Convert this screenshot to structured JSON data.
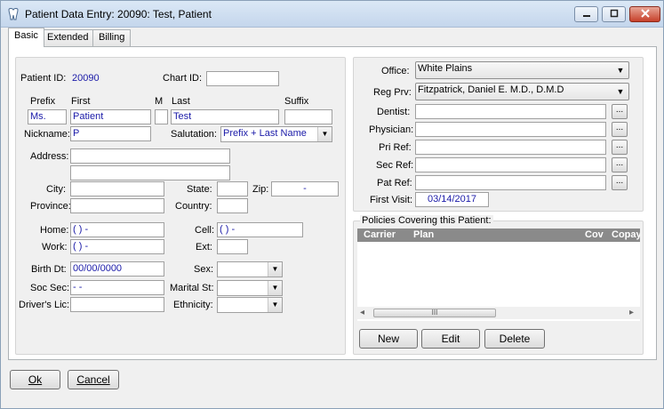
{
  "window": {
    "title": "Patient Data Entry: 20090: Test, Patient"
  },
  "tabs": [
    {
      "label": "Basic",
      "active": true
    },
    {
      "label": "Extended",
      "active": false
    },
    {
      "label": "Billing",
      "active": false
    }
  ],
  "patient": {
    "patient_id_label": "Patient ID:",
    "patient_id": "20090",
    "chart_id_label": "Chart ID:",
    "chart_id": "",
    "prefix_label": "Prefix",
    "first_label": "First",
    "m_label": "M",
    "last_label": "Last",
    "suffix_label": "Suffix",
    "prefix": "Ms.",
    "first": "Patient",
    "middle": "",
    "last": "Test",
    "suffix": "",
    "nickname_label": "Nickname:",
    "nickname": "P",
    "salutation_label": "Salutation:",
    "salutation": "Prefix + Last Name",
    "address_label": "Address:",
    "address1": "",
    "address2": "",
    "city_label": "City:",
    "city": "",
    "state_label": "State:",
    "state": "",
    "zip_label": "Zip:",
    "zip": "-",
    "province_label": "Province:",
    "province": "",
    "country_label": "Country:",
    "country": "",
    "home_label": "Home:",
    "home": "( )  -",
    "cell_label": "Cell:",
    "cell": "( )  -",
    "work_label": "Work:",
    "work": "( )  -",
    "ext_label": "Ext:",
    "ext": "",
    "birth_label": "Birth Dt:",
    "birth": "00/00/0000",
    "sex_label": "Sex:",
    "sex": "",
    "soc_label": "Soc Sec:",
    "soc": "-  -",
    "marital_label": "Marital St:",
    "marital": "",
    "license_label": "Driver's Lic:",
    "license": "",
    "ethnicity_label": "Ethnicity:",
    "ethnicity": ""
  },
  "provider": {
    "office_label": "Office:",
    "office": "White Plains",
    "regprv_label": "Reg Prv:",
    "regprv": "Fitzpatrick, Daniel E. M.D., D.M.D",
    "dentist_label": "Dentist:",
    "physician_label": "Physician:",
    "priref_label": "Pri Ref:",
    "secref_label": "Sec Ref:",
    "patref_label": "Pat Ref:",
    "firstvisit_label": "First Visit:",
    "firstvisit": "03/14/2017",
    "ellipsis": "..."
  },
  "policies": {
    "legend": "Policies Covering this Patient:",
    "columns": [
      "Carrier",
      "Plan",
      "Cov",
      "Copay"
    ],
    "new_label": "New",
    "edit_label": "Edit",
    "delete_label": "Delete",
    "scroll_grip": "III"
  },
  "footer": {
    "ok_label": "Ok",
    "cancel_label": "Cancel"
  },
  "glyphs": {
    "dropdown": "▼",
    "minimize": "▬",
    "maximize": "▢",
    "close": "✕",
    "arrow_left": "◂",
    "arrow_right": "▸"
  }
}
